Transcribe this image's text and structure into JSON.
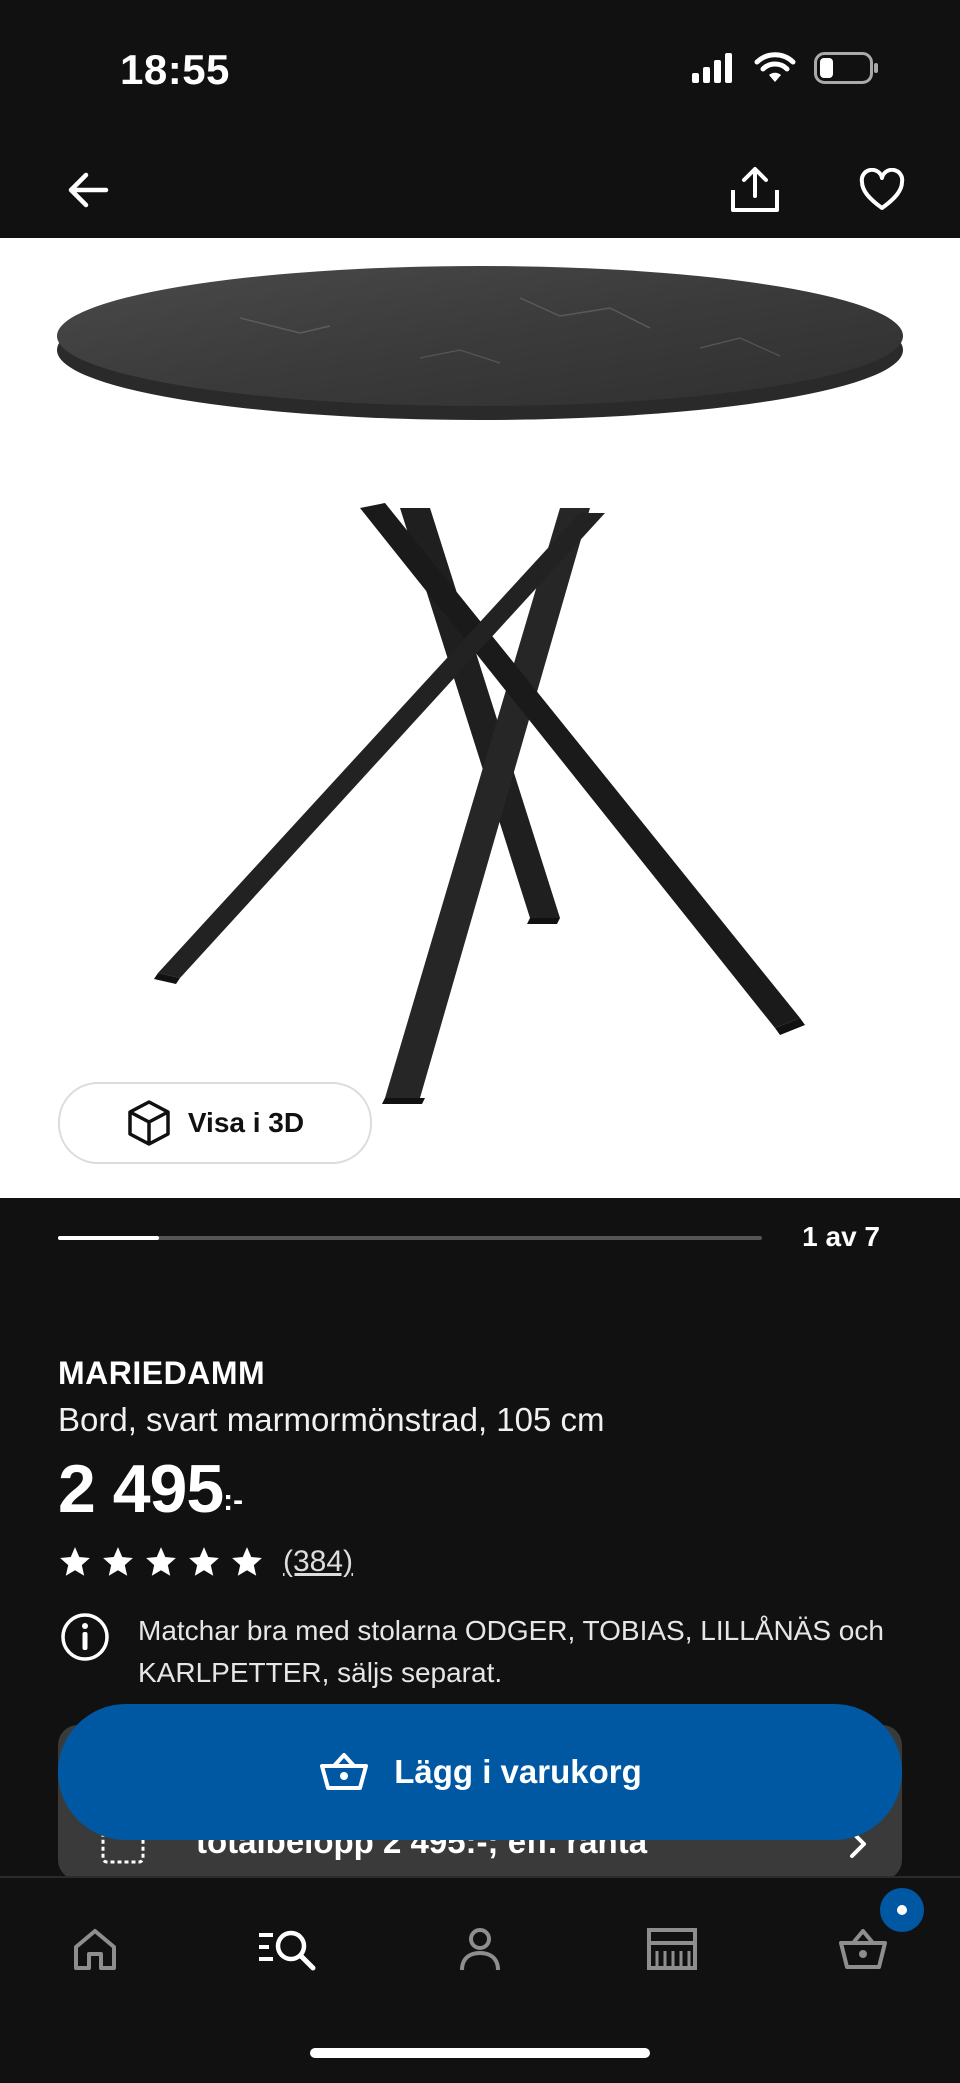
{
  "status_bar": {
    "time": "18:55",
    "signal_icon": "cellular-signal-icon",
    "wifi_icon": "wifi-icon",
    "battery_icon": "battery-icon"
  },
  "nav_bar": {
    "back_icon": "arrow-left-icon",
    "share_icon": "share-icon",
    "favorite_icon": "heart-icon"
  },
  "gallery": {
    "view_3d_label": "Visa i 3D",
    "pager_text": "1 av 7",
    "current_image": 1,
    "total_images": 7
  },
  "product": {
    "name": "MARIEDAMM",
    "description": "Bord, svart marmormönstrad, 105 cm",
    "price": "2 495",
    "price_suffix": ":-",
    "rating_stars": 5,
    "review_count": "(384)",
    "info_text": "Matchar bra med stolarna ODGER, TOBIAS, LILLÅNÄS och KARLPETTER, säljs separat."
  },
  "finance": {
    "text": "totalbelopp 2 495:-; eff. ränta"
  },
  "actions": {
    "add_to_cart_label": "Lägg i varukorg"
  },
  "bottom_nav": {
    "tabs": [
      "home-icon",
      "search-icon",
      "profile-icon",
      "store-icon",
      "cart-icon"
    ],
    "active_tab": "search-icon"
  },
  "colors": {
    "background": "#111111",
    "accent_blue": "#0058a3",
    "card": "#3a3a3a"
  }
}
